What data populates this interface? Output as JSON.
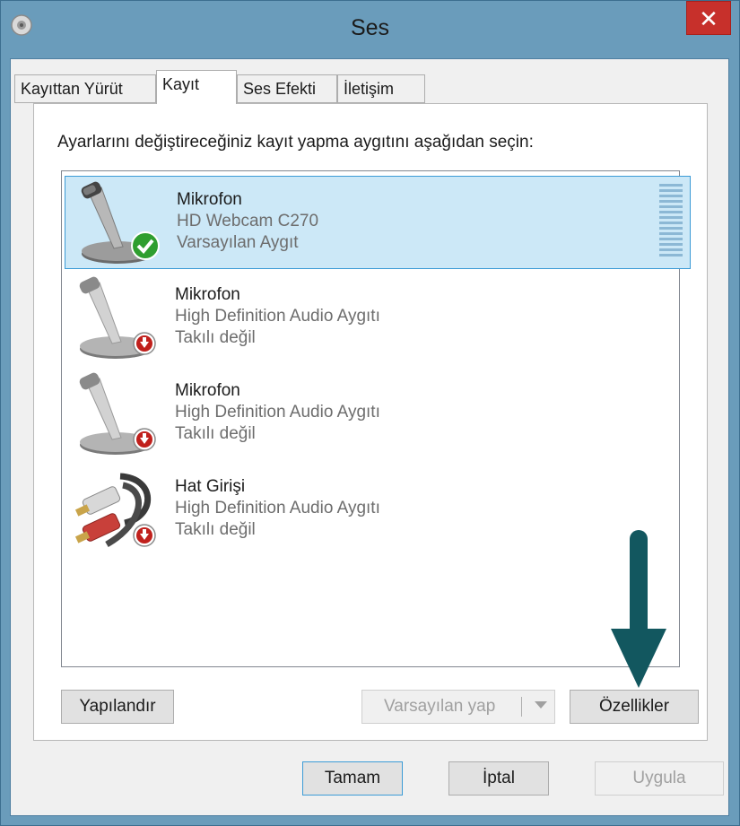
{
  "window": {
    "title": "Ses",
    "close_label": "✕"
  },
  "tabs": [
    {
      "label": "Kayıttan Yürüt",
      "active": false
    },
    {
      "label": "Kayıt",
      "active": true
    },
    {
      "label": "Ses Efekti",
      "active": false
    },
    {
      "label": "İletişim",
      "active": false
    }
  ],
  "panel": {
    "instruction": "Ayarlarını değiştireceğiniz kayıt yapma aygıtını aşağıdan seçin:"
  },
  "devices": [
    {
      "name": "Mikrofon",
      "description": "HD Webcam C270",
      "status": "Varsayılan Aygıt",
      "icon": "microphone-icon",
      "badge": "default-check-badge",
      "selected": true
    },
    {
      "name": "Mikrofon",
      "description": "High Definition Audio Aygıtı",
      "status": "Takılı değil",
      "icon": "microphone-icon",
      "badge": "unplugged-badge",
      "selected": false
    },
    {
      "name": "Mikrofon",
      "description": "High Definition Audio Aygıtı",
      "status": "Takılı değil",
      "icon": "microphone-icon",
      "badge": "unplugged-badge",
      "selected": false
    },
    {
      "name": "Hat Girişi",
      "description": "High Definition Audio Aygıtı",
      "status": "Takılı değil",
      "icon": "line-in-cable-icon",
      "badge": "unplugged-badge",
      "selected": false
    }
  ],
  "panel_buttons": {
    "configure": "Yapılandır",
    "set_default": "Varsayılan yap",
    "properties": "Özellikler"
  },
  "dialog_buttons": {
    "ok": "Tamam",
    "cancel": "İptal",
    "apply": "Uygula"
  },
  "colors": {
    "selection_bg": "#cce8f7",
    "selection_border": "#3c9bd6",
    "close_red": "#c7302b",
    "annotation_arrow": "#12575f"
  }
}
